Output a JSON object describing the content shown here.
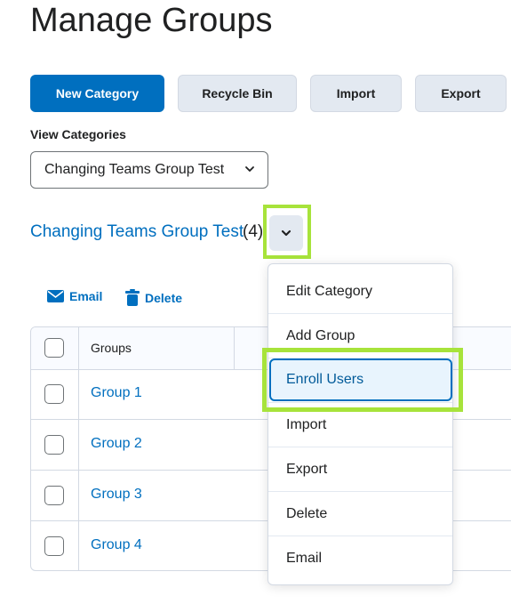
{
  "page": {
    "title": "Manage Groups"
  },
  "toolbar": {
    "new_category": "New Category",
    "recycle_bin": "Recycle Bin",
    "import": "Import",
    "export": "Export"
  },
  "view_categories": {
    "label": "View Categories",
    "selected": "Changing Teams Group Test"
  },
  "category": {
    "name": "Changing Teams Group Test",
    "count": "(4)"
  },
  "actions": {
    "email": "Email",
    "delete": "Delete"
  },
  "table": {
    "header": "Groups",
    "rows": [
      "Group 1",
      "Group 2",
      "Group 3",
      "Group 4"
    ]
  },
  "menu": {
    "items": [
      "Edit Category",
      "Add Group",
      "Enroll Users",
      "Import",
      "Export",
      "Delete",
      "Email"
    ]
  },
  "colors": {
    "primary": "#006fbf",
    "highlight": "#a7e33b",
    "secondary_button": "#e3e9f1"
  }
}
